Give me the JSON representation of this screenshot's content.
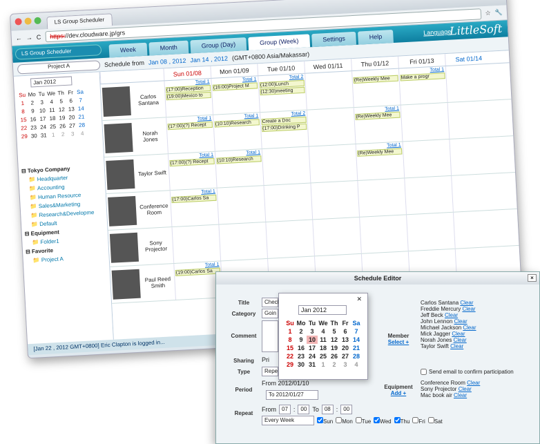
{
  "browser": {
    "tab": "LS Group Scheduler",
    "url_scheme": "https:",
    "url": "//dev.cloudware.jp/grs"
  },
  "nav": {
    "app": "LS Group Scheduler",
    "tabs": [
      "Week",
      "Month",
      "Group (Day)",
      "Group (Week)",
      "Settings",
      "Help"
    ],
    "language": "Language",
    "logo": "LittleSoft"
  },
  "toolbar": {
    "project": "Project A",
    "sched_from": "Schedule from",
    "from_date": "Jan 08 , 2012",
    "to_date": "Jan 14 , 2012",
    "tz": "(GMT+0800 Asia/Makassar)"
  },
  "sidebar": {
    "month": "Jan 2012",
    "weekdays": [
      "Su",
      "Mo",
      "Tu",
      "We",
      "Th",
      "Fr",
      "Sa"
    ],
    "weeks": [
      [
        "1",
        "2",
        "3",
        "4",
        "5",
        "6",
        "7"
      ],
      [
        "8",
        "9",
        "10",
        "11",
        "12",
        "13",
        "14"
      ],
      [
        "15",
        "16",
        "17",
        "18",
        "19",
        "20",
        "21"
      ],
      [
        "22",
        "23",
        "24",
        "25",
        "26",
        "27",
        "28"
      ],
      [
        "29",
        "30",
        "31",
        "1",
        "2",
        "3",
        "4"
      ]
    ],
    "tree": [
      "Tokyo Company",
      "Headquarter",
      "Accounting",
      "Human Resource",
      "Sales&Marketing",
      "Research&Developme",
      "Default",
      "Equipment",
      "Folder1",
      "Favorite",
      "Project A"
    ]
  },
  "grid": {
    "days": [
      "Sun 01/08",
      "Mon 01/09",
      "Tue 01/10",
      "Wed 01/11",
      "Thu 01/12",
      "Fri 01/13",
      "Sat 01/14"
    ],
    "rows": [
      {
        "name": "Carlos Santana",
        "cells": [
          [
            "Total 1",
            "(17:00)Reception",
            "(19:00)Mexico to"
          ],
          [
            "Total 1",
            "(16:00)Project M"
          ],
          [
            "Total 2",
            "(12:00)Lunch",
            "(12:30)meeting"
          ],
          [],
          [
            "",
            "(Re)Weekly Mee"
          ],
          [
            "Total 1",
            "Make a progr"
          ],
          []
        ]
      },
      {
        "name": "Norah Jones",
        "cells": [
          [
            "Total 1",
            "(17:00)(?) Recept"
          ],
          [
            "Total 1",
            "(10:10)Research"
          ],
          [
            "Total 2",
            "Create a Doc",
            "(17:00)Drinking P"
          ],
          [],
          [
            "Total 1",
            "(Re)Weekly Mee"
          ],
          [],
          []
        ]
      },
      {
        "name": "Taylor Swift",
        "cells": [
          [
            "Total 1",
            "(17:00)(?) Recept"
          ],
          [
            "Total 1",
            "(10:10)Research"
          ],
          [],
          [],
          [
            "Total 1",
            "(Re)Weekly Mee"
          ],
          [],
          []
        ]
      },
      {
        "name": "Conference Room",
        "cells": [
          [
            "Total 1",
            "(17:00)Carlos Sa"
          ],
          [],
          [],
          [],
          [],
          [],
          []
        ]
      },
      {
        "name": "Sony Projector",
        "cells": [
          [],
          [],
          [],
          [],
          [],
          [],
          []
        ]
      },
      {
        "name": "Paul Reed Smith",
        "cells": [
          [
            "Total 1",
            "(19:00)Carlos Sa"
          ],
          [],
          [],
          [],
          [],
          [],
          []
        ]
      }
    ]
  },
  "status": "[Jan 22 , 2012 GMT+0800] Eric Clapton is logged in...",
  "editor": {
    "title": "Schedule Editor",
    "labels": {
      "title": "Title",
      "category": "Category",
      "comment": "Comment",
      "sharing": "Sharing",
      "type": "Type",
      "period": "Period",
      "repeat": "Repeat",
      "member": "Member",
      "equipment": "Equipment"
    },
    "title_val": "Check",
    "category_val": "Goin",
    "type_val": "Repe",
    "sharing_val": "Pri",
    "add_member": "Select +",
    "add_equip": "Add +",
    "period_from": "From 2012/01/10",
    "period_to": "To 2012/01/27",
    "members": [
      "Carlos Santana",
      "Freddie Mercury",
      "Jeff Beck",
      "John Lennon",
      "Michael Jackson",
      "Mick Jagger",
      "Norah Jones",
      "Taylor Swift"
    ],
    "clear": "Clear",
    "confirm": "Send email to confirm participation",
    "equipment": [
      "Conference Room",
      "Sony Projector",
      "Mac book air"
    ],
    "repeat": {
      "from": "From",
      "h1": "07",
      "m1": "00",
      "to": "To",
      "h2": "08",
      "m2": "00",
      "freq": "Every Week",
      "days": [
        "Sun",
        "Mon",
        "Tue",
        "Wed",
        "Thu",
        "Fri",
        "Sat"
      ],
      "checked": [
        true,
        false,
        false,
        true,
        true,
        false,
        false
      ]
    }
  },
  "picker": {
    "month": "Jan 2012",
    "selected": "10"
  }
}
